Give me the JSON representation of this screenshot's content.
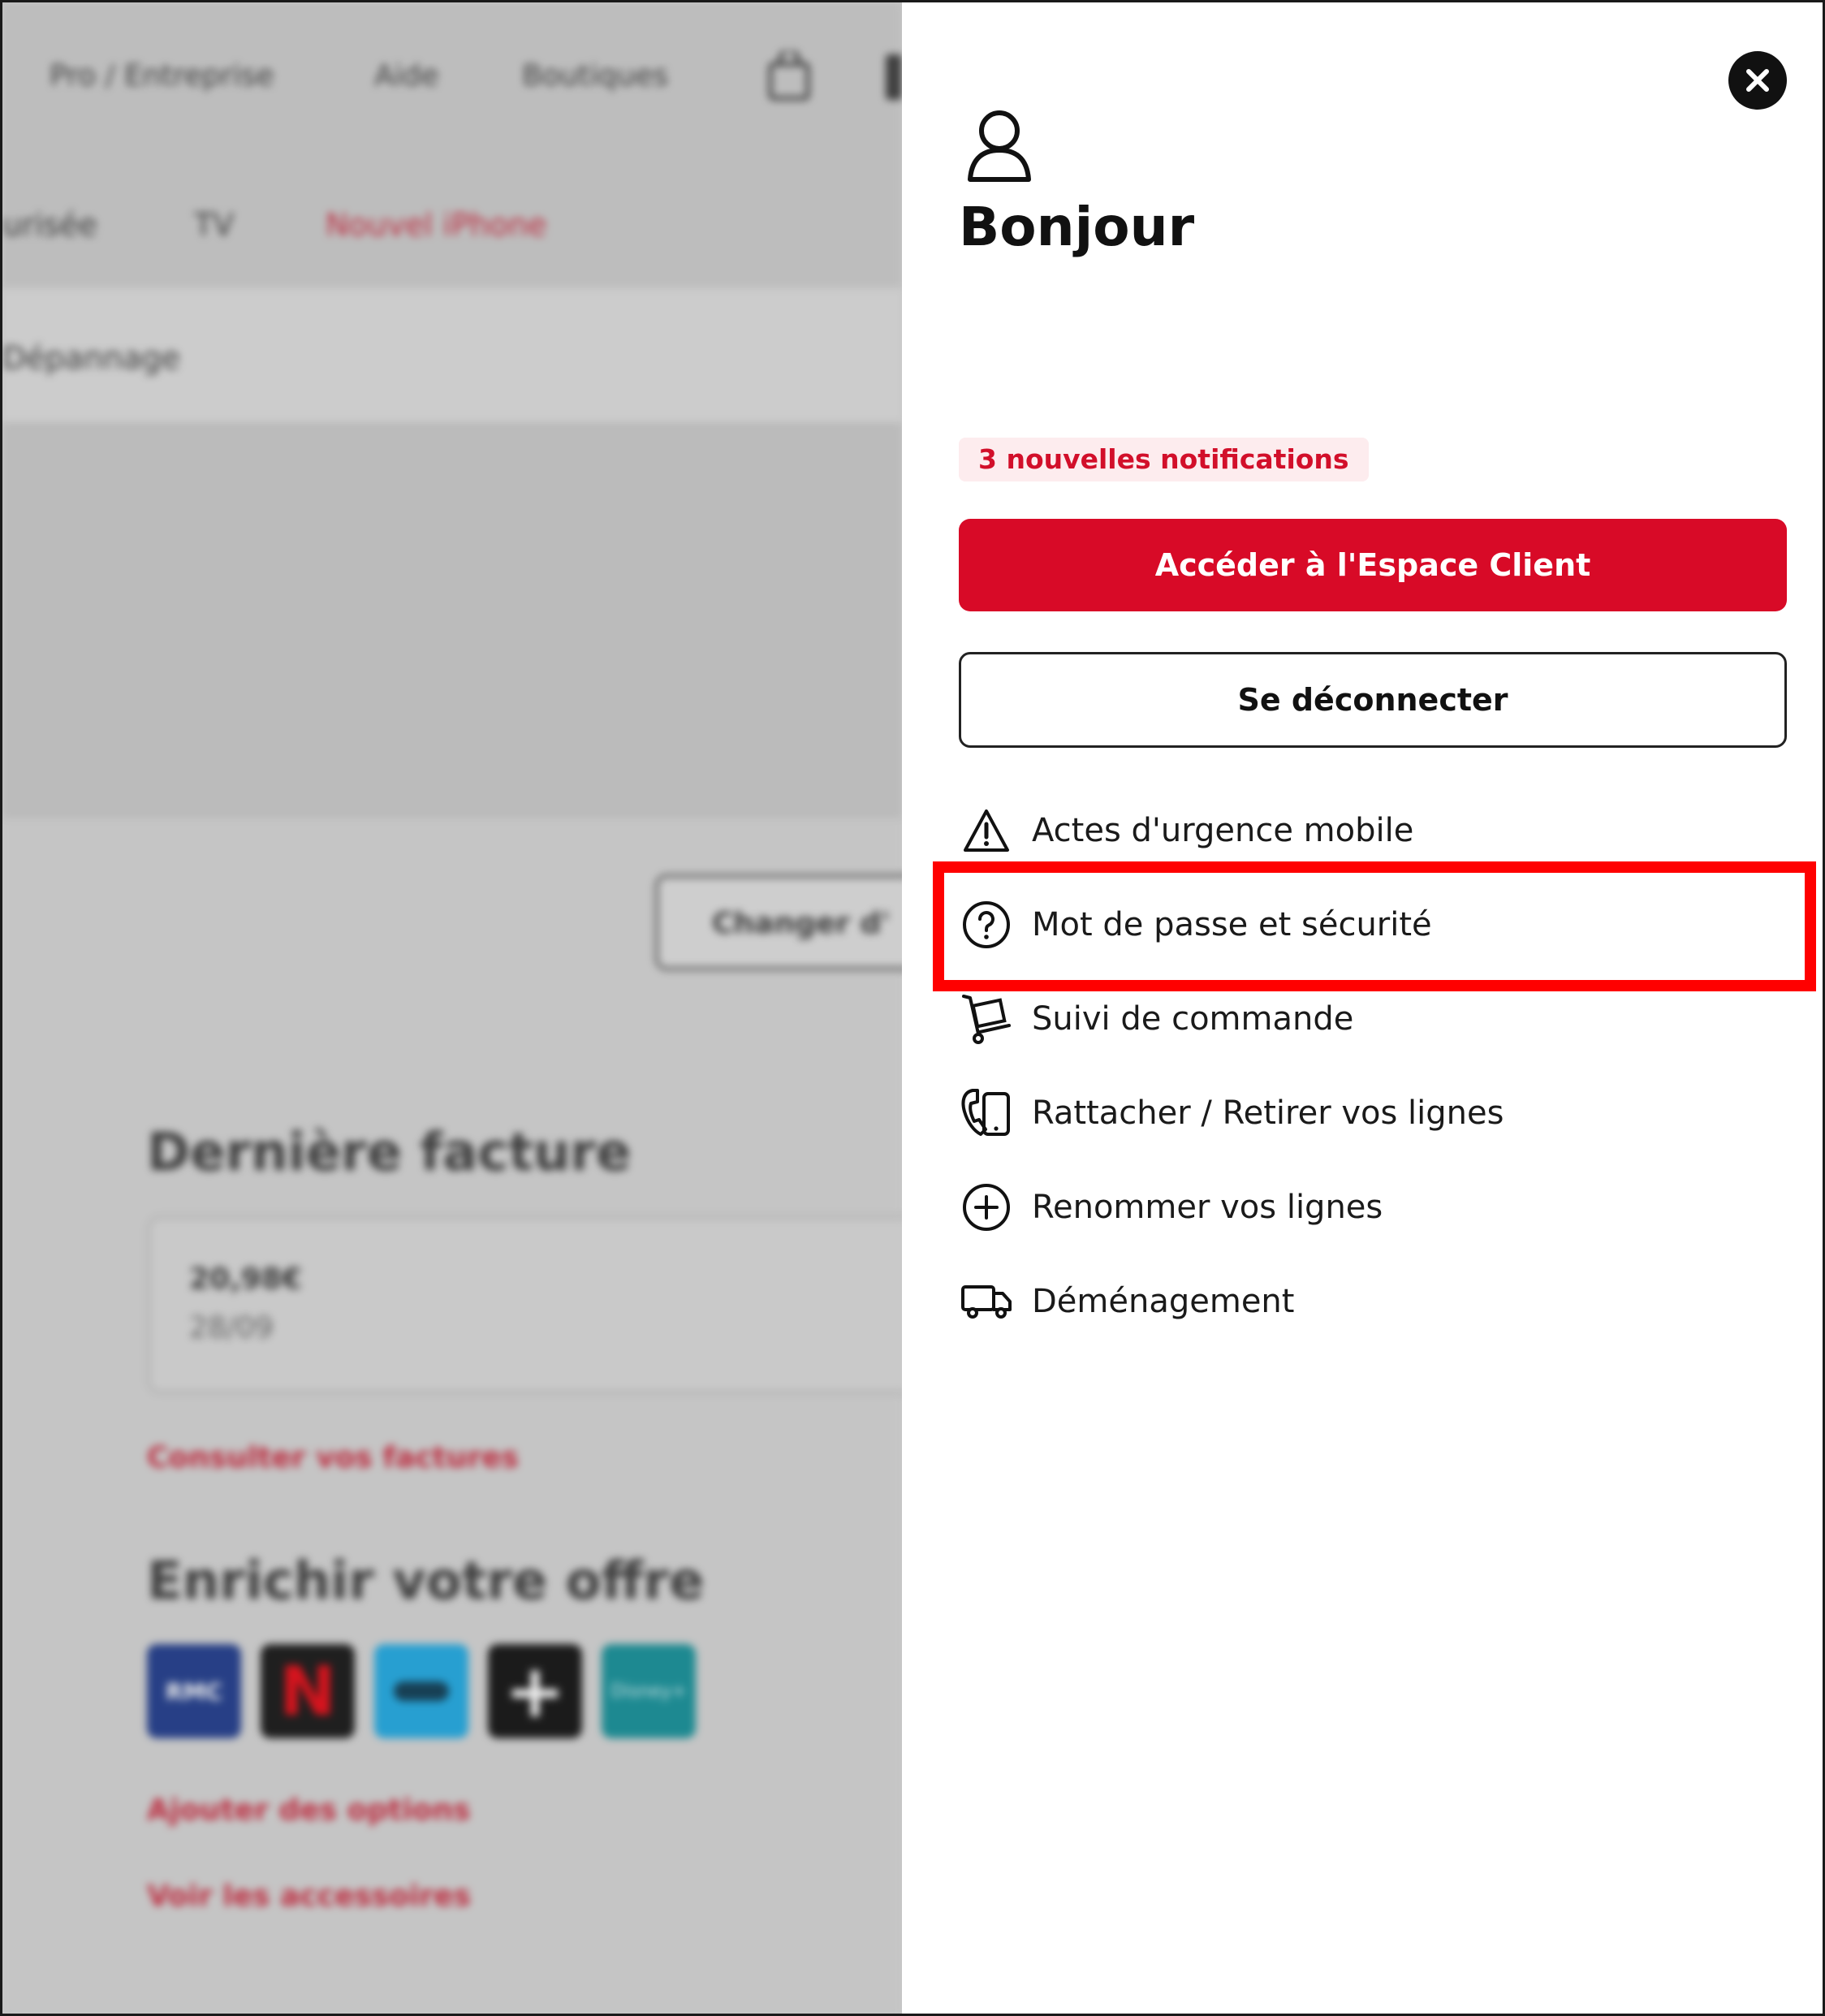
{
  "background_page": {
    "top_nav": [
      {
        "label": "Pro / Entreprise"
      },
      {
        "label": "Aide"
      },
      {
        "label": "Boutiques"
      }
    ],
    "sub_nav": [
      {
        "label": "urisée"
      },
      {
        "label": "TV"
      },
      {
        "label": "Nouvel iPhone"
      }
    ],
    "breadcrumb_fragment": "Dépannage",
    "change_button_label": "Changer d'",
    "last_invoice": {
      "title": "Dernière facture",
      "amount": "20,98€",
      "date": "28/09",
      "link": "Consulter vos factures"
    },
    "enrich_offer": {
      "title": "Enrichir votre offre",
      "tiles": [
        {
          "icon": "tv-service-icon",
          "color": "#1e3a8a",
          "text": "RMC"
        },
        {
          "icon": "netflix-icon",
          "color": "#151515",
          "text": "N"
        },
        {
          "icon": "prime-video-icon",
          "color": "#1ea7e0",
          "text": ""
        },
        {
          "icon": "plus-service-icon",
          "color": "#111111",
          "text": "+"
        },
        {
          "icon": "disney-plus-icon",
          "color": "#138e97",
          "text": "Disney+"
        }
      ],
      "links": [
        "Ajouter des options",
        "Voir les accessoires"
      ]
    }
  },
  "drawer": {
    "greeting": "Bonjour",
    "notifications_badge": "3 nouvelles notifications",
    "primary_button": "Accéder à l'Espace Client",
    "secondary_button": "Se déconnecter",
    "menu": [
      {
        "label": "Actes d'urgence mobile",
        "icon": "warning-triangle-icon"
      },
      {
        "label": "Mot de passe et sécurité",
        "icon": "question-circle-icon"
      },
      {
        "label": "Suivi de commande",
        "icon": "hand-truck-icon"
      },
      {
        "label": "Rattacher / Retirer vos lignes",
        "icon": "phone-handset-icon"
      },
      {
        "label": "Renommer vos lignes",
        "icon": "plus-circle-icon"
      },
      {
        "label": "Déménagement",
        "icon": "moving-truck-icon"
      }
    ]
  },
  "colors": {
    "brand_red": "#d80a27",
    "badge_bg": "#fdecee",
    "highlight_red": "#ff0000",
    "overlay_gray": "#d4d4d4"
  }
}
